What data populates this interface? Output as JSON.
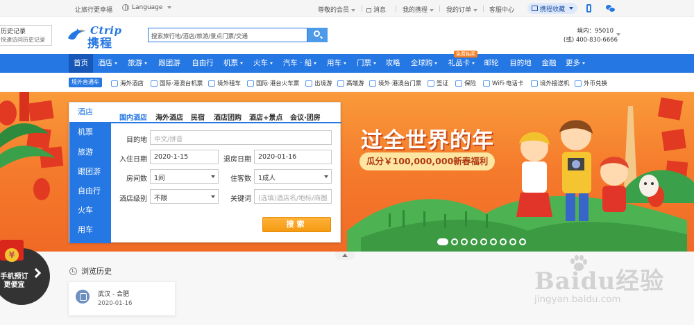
{
  "topbar": {
    "slogan": "让旅行更幸福",
    "language": "Language",
    "links": [
      {
        "label": "尊敬的会员",
        "has_caret": true
      },
      {
        "label": "消息",
        "has_caret": false
      },
      {
        "label": "我的携程",
        "has_caret": true
      },
      {
        "label": "我的订单",
        "has_caret": true
      },
      {
        "label": "客服中心",
        "has_caret": false
      }
    ],
    "favorites": "携程收藏"
  },
  "header": {
    "history_tab_title": "历史记录",
    "history_tab_sub": "快速访问历史记录",
    "logo_en": "Ctrip",
    "logo_cn": "携程",
    "search_placeholder": "搜索旅行地/酒店/旅游/景点门票/交通",
    "hotline_domestic": "境内：95010",
    "hotline_intl": "(或) 400-830-6666"
  },
  "nav": {
    "items": [
      {
        "label": "首页",
        "active": true,
        "caret": false
      },
      {
        "label": "酒店",
        "caret": true
      },
      {
        "label": "旅游",
        "caret": true
      },
      {
        "label": "跟团游",
        "caret": false
      },
      {
        "label": "自由行",
        "caret": false
      },
      {
        "label": "机票",
        "caret": true
      },
      {
        "label": "火车",
        "caret": true
      },
      {
        "label": "汽车 · 船",
        "caret": true
      },
      {
        "label": "用车",
        "caret": true
      },
      {
        "label": "门票",
        "caret": true
      },
      {
        "label": "攻略",
        "caret": false
      },
      {
        "label": "全球购",
        "caret": true
      },
      {
        "label": "礼品卡",
        "caret": true
      },
      {
        "label": "邮轮",
        "caret": false
      },
      {
        "label": "目的地",
        "caret": false
      },
      {
        "label": "金融",
        "caret": false
      },
      {
        "label": "更多",
        "caret": true
      }
    ],
    "promo_badge": "免费抽奖"
  },
  "subnav": {
    "badge": "境外直通车",
    "items": [
      "海外酒店",
      "国际·港澳台机票",
      "境外租车",
      "国际·港台火车票",
      "出境游",
      "高端游",
      "境外·港澳台门票",
      "签证",
      "保险",
      "WiFi·电话卡",
      "境外接送机",
      "外币兑换"
    ]
  },
  "banner": {
    "title": "过全世界的年",
    "subtitle": "瓜分￥100,000,000新春福利",
    "slide_count": 9,
    "active_slide": 1
  },
  "booking": {
    "side_tabs": [
      "酒店",
      "机票",
      "旅游",
      "跟团游",
      "自由行",
      "火车",
      "用车"
    ],
    "active_side_tab": "酒店",
    "hotel_tabs": [
      "国内酒店",
      "海外酒店",
      "民宿",
      "酒店团购",
      "酒店+景点",
      "会议·团房"
    ],
    "active_hotel_tab": "国内酒店",
    "fields": {
      "destination_label": "目的地",
      "destination_placeholder": "中文/拼音",
      "checkin_label": "入住日期",
      "checkin_value": "2020-1-15",
      "checkout_label": "退房日期",
      "checkout_value": "2020-01-16",
      "rooms_label": "房间数",
      "rooms_value": "1间",
      "guests_label": "住客数",
      "guests_value": "1成人",
      "level_label": "酒店级别",
      "level_value": "不限",
      "keyword_label": "关键词",
      "keyword_placeholder": "(选填)酒店名/地标/商圈"
    },
    "search_button": "搜索"
  },
  "history": {
    "title": "浏览历史",
    "route": "武汉 - 合肥",
    "date": "2020-01-16"
  },
  "mobile_promo": {
    "line1": "手机预订",
    "line2": "更便宜",
    "coin": "¥"
  },
  "watermark": {
    "brand": "Baidu经验",
    "url": "jingyan.baidu.com"
  },
  "colors": {
    "brand_blue": "#2577e3",
    "nav_active": "#1657b8",
    "banner_orange": "#f57a2c",
    "search_orange": "#f59a12"
  }
}
